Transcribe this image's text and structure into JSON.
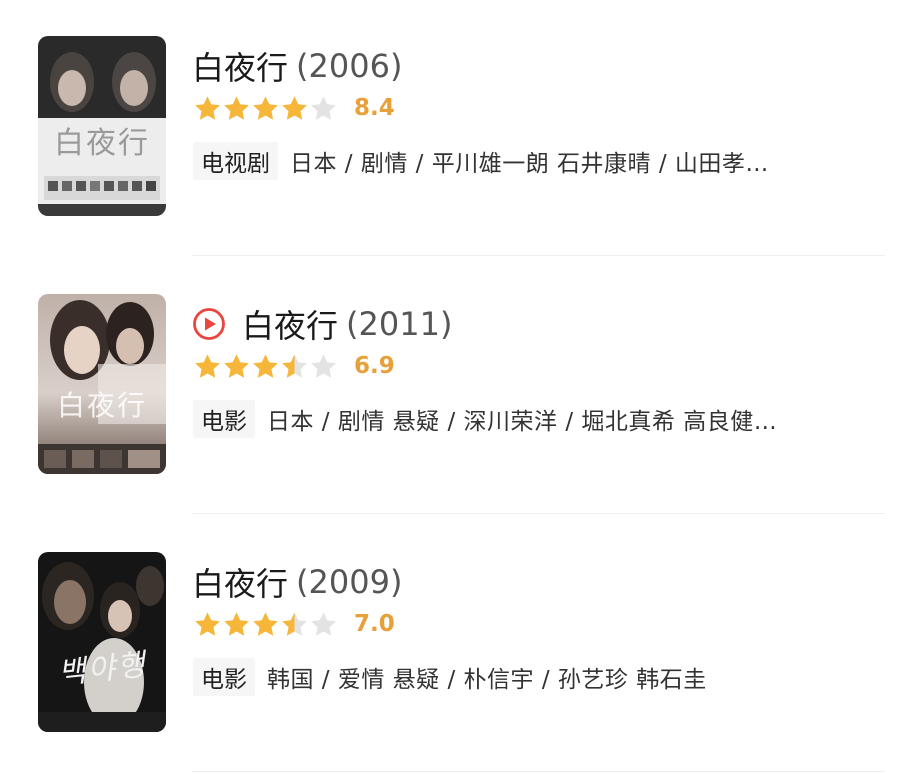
{
  "results": [
    {
      "title": "白夜行",
      "year": "(2006)",
      "has_play_icon": false,
      "rating": 8.4,
      "rating_text": "8.4",
      "stars": [
        "full",
        "full",
        "full",
        "full",
        "empty"
      ],
      "type": "电视剧",
      "meta": "日本 / 剧情 / 平川雄一朗 石井康晴 / 山田孝…",
      "poster_text": "白夜行",
      "poster_icon": "poster-image"
    },
    {
      "title": "白夜行",
      "year": "(2011)",
      "has_play_icon": true,
      "rating": 6.9,
      "rating_text": "6.9",
      "stars": [
        "full",
        "full",
        "full",
        "half",
        "empty"
      ],
      "type": "电影",
      "meta": "日本 / 剧情 悬疑 / 深川荣洋 / 堀北真希 高良健…",
      "poster_text": "白夜行",
      "poster_icon": "poster-image"
    },
    {
      "title": "白夜行",
      "year": "(2009)",
      "has_play_icon": false,
      "rating": 7.0,
      "rating_text": "7.0",
      "stars": [
        "full",
        "full",
        "full",
        "half",
        "empty"
      ],
      "type": "电影",
      "meta": "韩国 / 爱情 悬疑 / 朴信宇 / 孙艺珍 韩石圭",
      "poster_text": "백야행",
      "poster_icon": "poster-image"
    }
  ],
  "colors": {
    "star_fill": "#f5b63a",
    "star_empty": "#e3e3e3",
    "score": "#e8a13a",
    "play_icon": "#e8463e"
  }
}
